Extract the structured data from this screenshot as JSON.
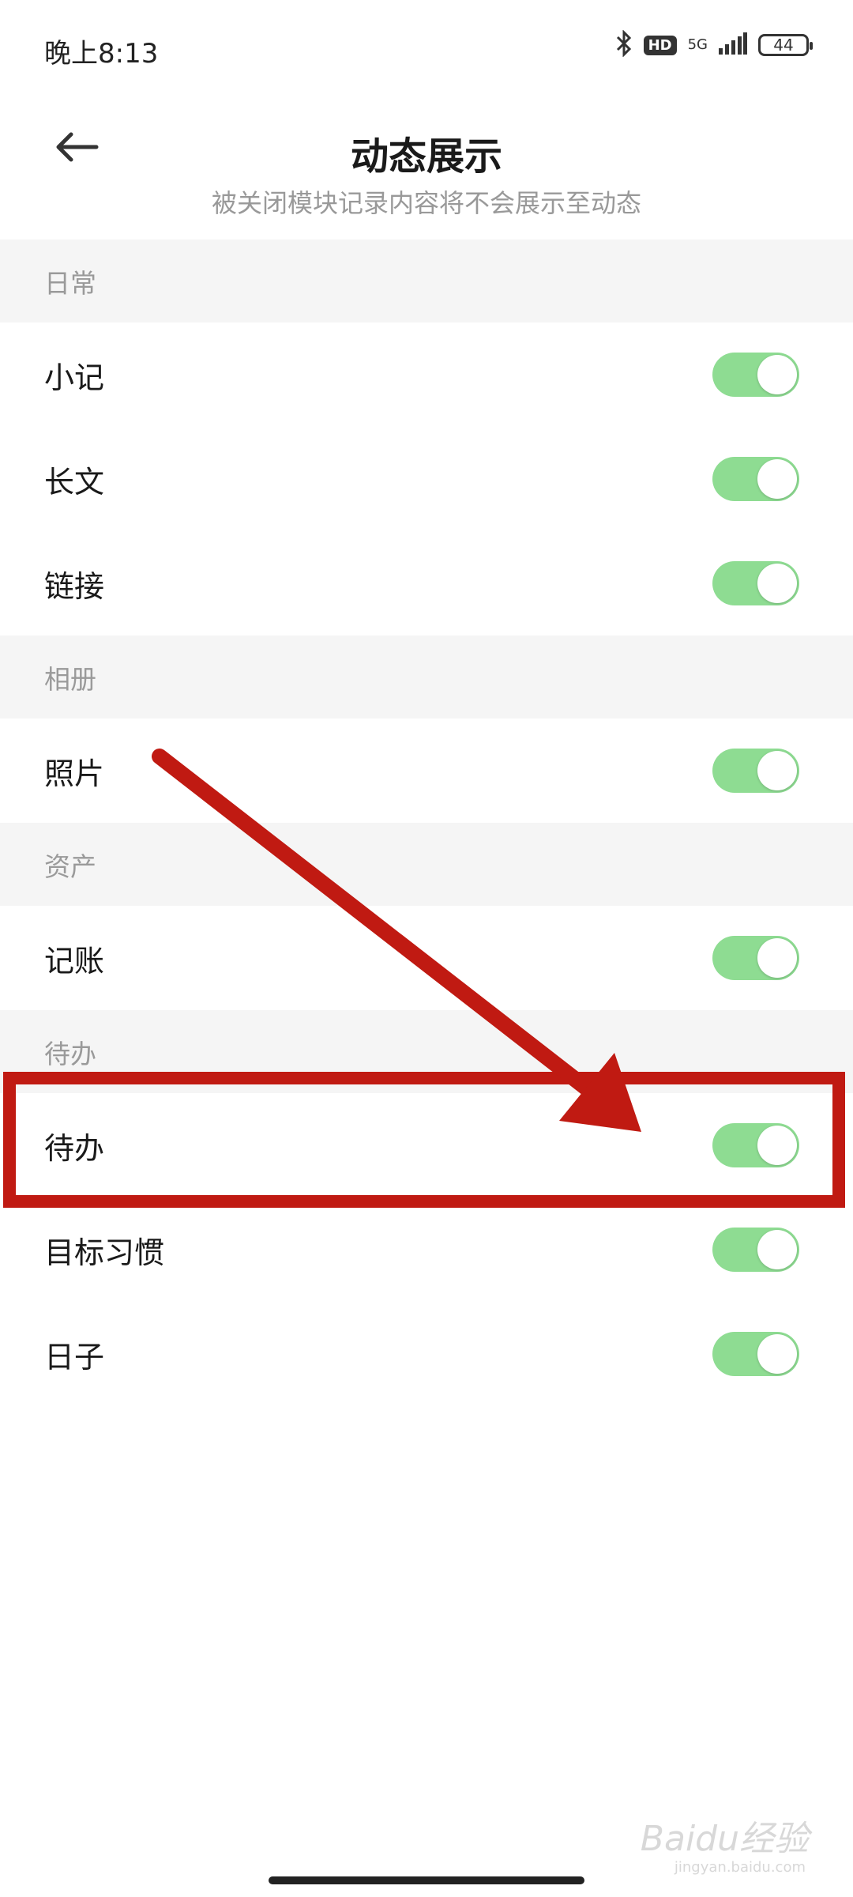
{
  "status_bar": {
    "time": "晚上8:13",
    "hd": "HD",
    "network": "5G",
    "battery": "44"
  },
  "header": {
    "title": "动态展示",
    "subtitle": "被关闭模块记录内容将不会展示至动态"
  },
  "sections": [
    {
      "title": "日常",
      "items": [
        {
          "label": "小记",
          "on": true
        },
        {
          "label": "长文",
          "on": true
        },
        {
          "label": "链接",
          "on": true
        }
      ]
    },
    {
      "title": "相册",
      "items": [
        {
          "label": "照片",
          "on": true
        }
      ]
    },
    {
      "title": "资产",
      "items": [
        {
          "label": "记账",
          "on": true
        }
      ]
    },
    {
      "title": "待办",
      "items": [
        {
          "label": "待办",
          "on": true
        },
        {
          "label": "目标习惯",
          "on": true
        },
        {
          "label": "日子",
          "on": true
        }
      ]
    }
  ],
  "watermark": {
    "text": "Baidu经验",
    "sub": "jingyan.baidu.com"
  },
  "colors": {
    "toggle_on": "#8edc92",
    "annotation_red": "#c01a12",
    "section_bg": "#f5f5f5"
  },
  "icons": {
    "back": "arrow-left-icon",
    "bluetooth": "bluetooth-icon",
    "signal": "signal-icon"
  }
}
